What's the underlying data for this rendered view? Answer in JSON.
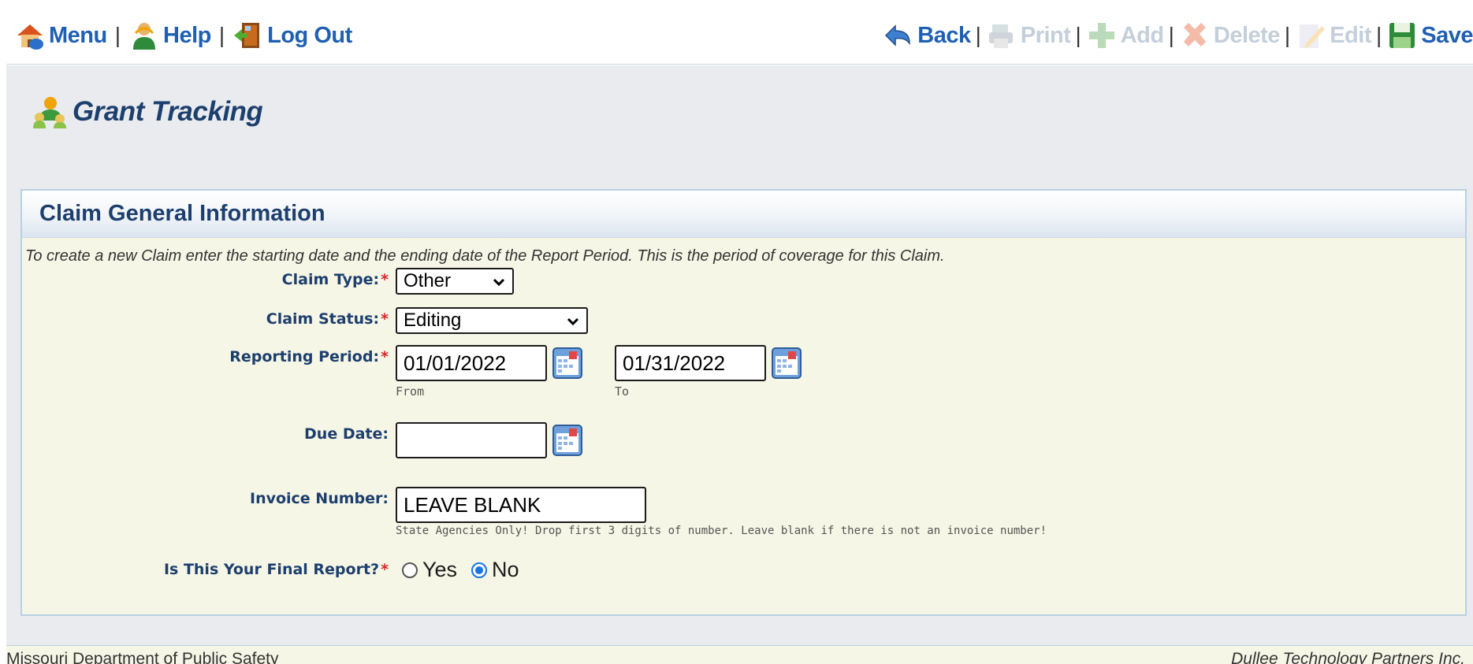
{
  "toolbar": {
    "left": {
      "menu": "Menu",
      "help": "Help",
      "logout": "Log Out"
    },
    "right": {
      "back": "Back",
      "print": "Print",
      "add": "Add",
      "delete": "Delete",
      "edit": "Edit",
      "save": "Save"
    },
    "separator": "|"
  },
  "app": {
    "title": "Grant Tracking"
  },
  "panel": {
    "title": "Claim General Information",
    "instructions": "To create a new Claim enter the starting date and the ending date of the Report Period. This is the period of coverage for this Claim."
  },
  "form": {
    "claim_type": {
      "label": "Claim Type:",
      "required": "*",
      "value": "Other"
    },
    "claim_status": {
      "label": "Claim Status:",
      "required": "*",
      "value": "Editing"
    },
    "reporting_period": {
      "label": "Reporting Period:",
      "required": "*",
      "from_value": "01/01/2022",
      "from_hint": "From",
      "to_value": "01/31/2022",
      "to_hint": "To"
    },
    "due_date": {
      "label": "Due Date:",
      "value": ""
    },
    "invoice_number": {
      "label": "Invoice Number:",
      "value": "LEAVE BLANK",
      "hint": "State Agencies Only! Drop first 3 digits of number. Leave blank if there is not an invoice number!"
    },
    "final_report": {
      "label": "Is This Your Final Report?",
      "required": "*",
      "yes_label": "Yes",
      "no_label": "No",
      "selected": "No"
    }
  },
  "footer": {
    "left": "Missouri Department of Public Safety",
    "right": "Dullee Technology Partners Inc."
  },
  "colors": {
    "link_blue": "#1f5fb4",
    "disabled": "#c4cfdb",
    "title_navy": "#1d3f6e",
    "panel_bg": "#f6f6e6",
    "page_bg": "#e9ebee",
    "required_red": "#d8262b"
  },
  "icons": [
    "home-icon",
    "help-person-icon",
    "door-exit-icon",
    "back-arrow-icon",
    "printer-icon",
    "add-plus-icon",
    "delete-x-icon",
    "edit-pencil-icon",
    "save-disk-icon",
    "people-group-icon",
    "calendar-icon"
  ]
}
